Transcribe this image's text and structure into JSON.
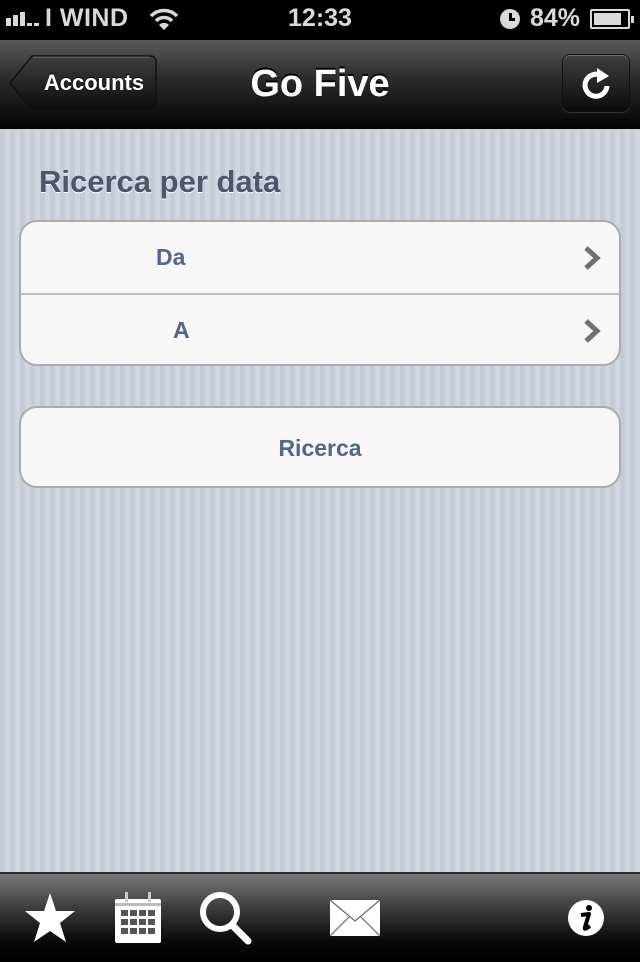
{
  "status_bar": {
    "signal_bars": 3,
    "signal_max": 5,
    "carrier": "I WIND",
    "time": "12:33",
    "battery_percent": "84%",
    "battery_level": 0.84
  },
  "nav_bar": {
    "back_label": "Accounts",
    "title": "Go Five",
    "refresh_icon": "refresh-icon"
  },
  "main": {
    "section_title": "Ricerca per data",
    "date_rows": [
      {
        "label": "Da",
        "icon": "chevron-right-icon"
      },
      {
        "label": "A",
        "icon": "chevron-right-icon"
      }
    ],
    "search_button_label": "Ricerca"
  },
  "tab_bar": {
    "items": [
      {
        "icon": "star-icon"
      },
      {
        "icon": "calendar-icon"
      },
      {
        "icon": "search-icon"
      },
      {
        "icon": "mail-icon"
      },
      {
        "icon": "info-icon"
      }
    ]
  },
  "colors": {
    "label_text": "#52668f",
    "section_title": "#4c566c",
    "background": "#cbd2dc"
  }
}
